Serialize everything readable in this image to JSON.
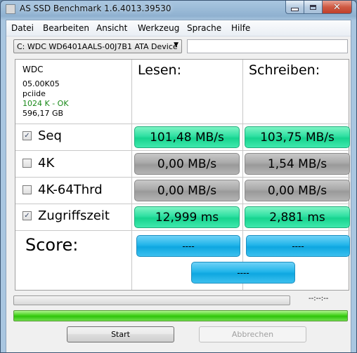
{
  "window": {
    "title": "AS SSD Benchmark 1.6.4013.39530"
  },
  "menu": [
    "Datei",
    "Bearbeiten",
    "Ansicht",
    "Werkzeug",
    "Sprache",
    "Hilfe"
  ],
  "drive": {
    "selected": "C: WDC WD6401AALS-00J7B1 ATA Device",
    "textbox_value": ""
  },
  "info": {
    "vendor": "WDC",
    "firmware": "05.00K05",
    "driver": "pciide",
    "alignment": "1024 K - OK",
    "capacity": "596,17 GB"
  },
  "columns": {
    "read": "Lesen:",
    "write": "Schreiben:"
  },
  "rows": [
    {
      "label": "Seq",
      "checked": true,
      "read": "101,48 MB/s",
      "write": "103,75 MB/s",
      "read_style": "green",
      "write_style": "green"
    },
    {
      "label": "4K",
      "checked": false,
      "read": "0,00 MB/s",
      "write": "1,54 MB/s",
      "read_style": "gray",
      "write_style": "gray"
    },
    {
      "label": "4K-64Thrd",
      "checked": false,
      "read": "0,00 MB/s",
      "write": "0,00 MB/s",
      "read_style": "gray",
      "write_style": "gray"
    },
    {
      "label": "Zugriffszeit",
      "checked": true,
      "read": "12,999 ms",
      "write": "2,881 ms",
      "read_style": "green",
      "write_style": "green"
    }
  ],
  "score": {
    "label": "Score:",
    "read": "----",
    "write": "----",
    "total": "----"
  },
  "progress": {
    "upper_fraction": 0.0,
    "time": "--:--:--",
    "lower_fraction": 1.0
  },
  "buttons": {
    "start": "Start",
    "abort": "Abbrechen"
  },
  "icons": {
    "minimize": "minimize-icon",
    "maximize": "maximize-icon",
    "close": "close-icon"
  },
  "colors": {
    "good": "#2fe0a2",
    "inactive": "#a9a9a9",
    "score": "#22b5ea",
    "progress": "#45d11d",
    "alignment_ok": "#1a8a1a"
  }
}
